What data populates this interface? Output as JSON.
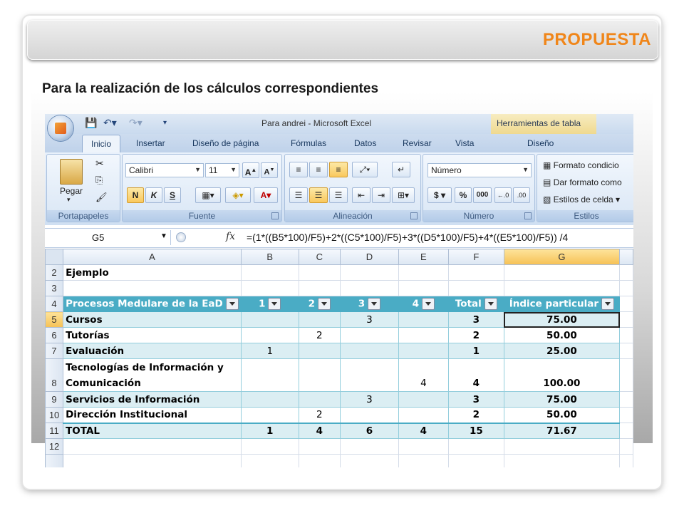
{
  "slide": {
    "title": "PROPUESTA",
    "subtitle": "Para la realización de los cálculos correspondientes",
    "title_color": "#f0861a"
  },
  "excel": {
    "window_title": "Para andrei - Microsoft Excel",
    "contextual_tab": "Herramientas de tabla",
    "tabs": [
      "Inicio",
      "Insertar",
      "Diseño de página",
      "Fórmulas",
      "Datos",
      "Revisar",
      "Vista",
      "Diseño"
    ],
    "ribbon": {
      "clipboard": {
        "paste_label": "Pegar",
        "group_label": "Portapapeles"
      },
      "font": {
        "font_name": "Calibri",
        "font_size": "11",
        "bold": "N",
        "italic": "K",
        "underline": "S",
        "group_label": "Fuente"
      },
      "alignment": {
        "group_label": "Alineación"
      },
      "number": {
        "format": "Número",
        "currency": "$",
        "percent": "%",
        "thousands": "000",
        "group_label": "Número"
      },
      "styles": {
        "conditional": "Formato condicio",
        "table_format": "Dar formato como",
        "cell_styles": "Estilos de celda",
        "group_label": "Estilos"
      }
    },
    "formula_bar": {
      "name_box": "G5",
      "fx": "fx",
      "formula": "=(1*((B5*100)/F5)+2*((C5*100)/F5)+3*((D5*100)/F5)+4*((E5*100)/F5)) /4"
    },
    "columns": [
      "A",
      "B",
      "C",
      "D",
      "E",
      "F",
      "G"
    ],
    "rows": [
      {
        "num": "2",
        "cells": [
          "Ejemplo",
          "",
          "",
          "",
          "",
          "",
          ""
        ]
      },
      {
        "num": "3",
        "cells": [
          "",
          "",
          "",
          "",
          "",
          "",
          ""
        ]
      },
      {
        "num": "4",
        "cells": [
          "Procesos Medulare de la EaD",
          "1",
          "2",
          "3",
          "4",
          "Total",
          "Índice particular"
        ]
      },
      {
        "num": "5",
        "cells": [
          "Cursos",
          "",
          "",
          "3",
          "",
          "3",
          "75.00"
        ]
      },
      {
        "num": "6",
        "cells": [
          "Tutorías",
          "",
          "2",
          "",
          "",
          "2",
          "50.00"
        ]
      },
      {
        "num": "7",
        "cells": [
          "Evaluación",
          "1",
          "",
          "",
          "",
          "1",
          "25.00"
        ]
      },
      {
        "num": "8",
        "cells": [
          "Tecnologías de Información y Comunicación",
          "",
          "",
          "",
          "4",
          "4",
          "100.00"
        ]
      },
      {
        "num": "9",
        "cells": [
          "Servicios de Información",
          "",
          "",
          "3",
          "",
          "3",
          "75.00"
        ]
      },
      {
        "num": "10",
        "cells": [
          "Dirección Institucional",
          "",
          "2",
          "",
          "",
          "2",
          "50.00"
        ]
      },
      {
        "num": "11",
        "cells": [
          "TOTAL",
          "1",
          "4",
          "6",
          "4",
          "15",
          "71.67"
        ]
      },
      {
        "num": "12",
        "cells": [
          "",
          "",
          "",
          "",
          "",
          "",
          ""
        ]
      }
    ]
  }
}
